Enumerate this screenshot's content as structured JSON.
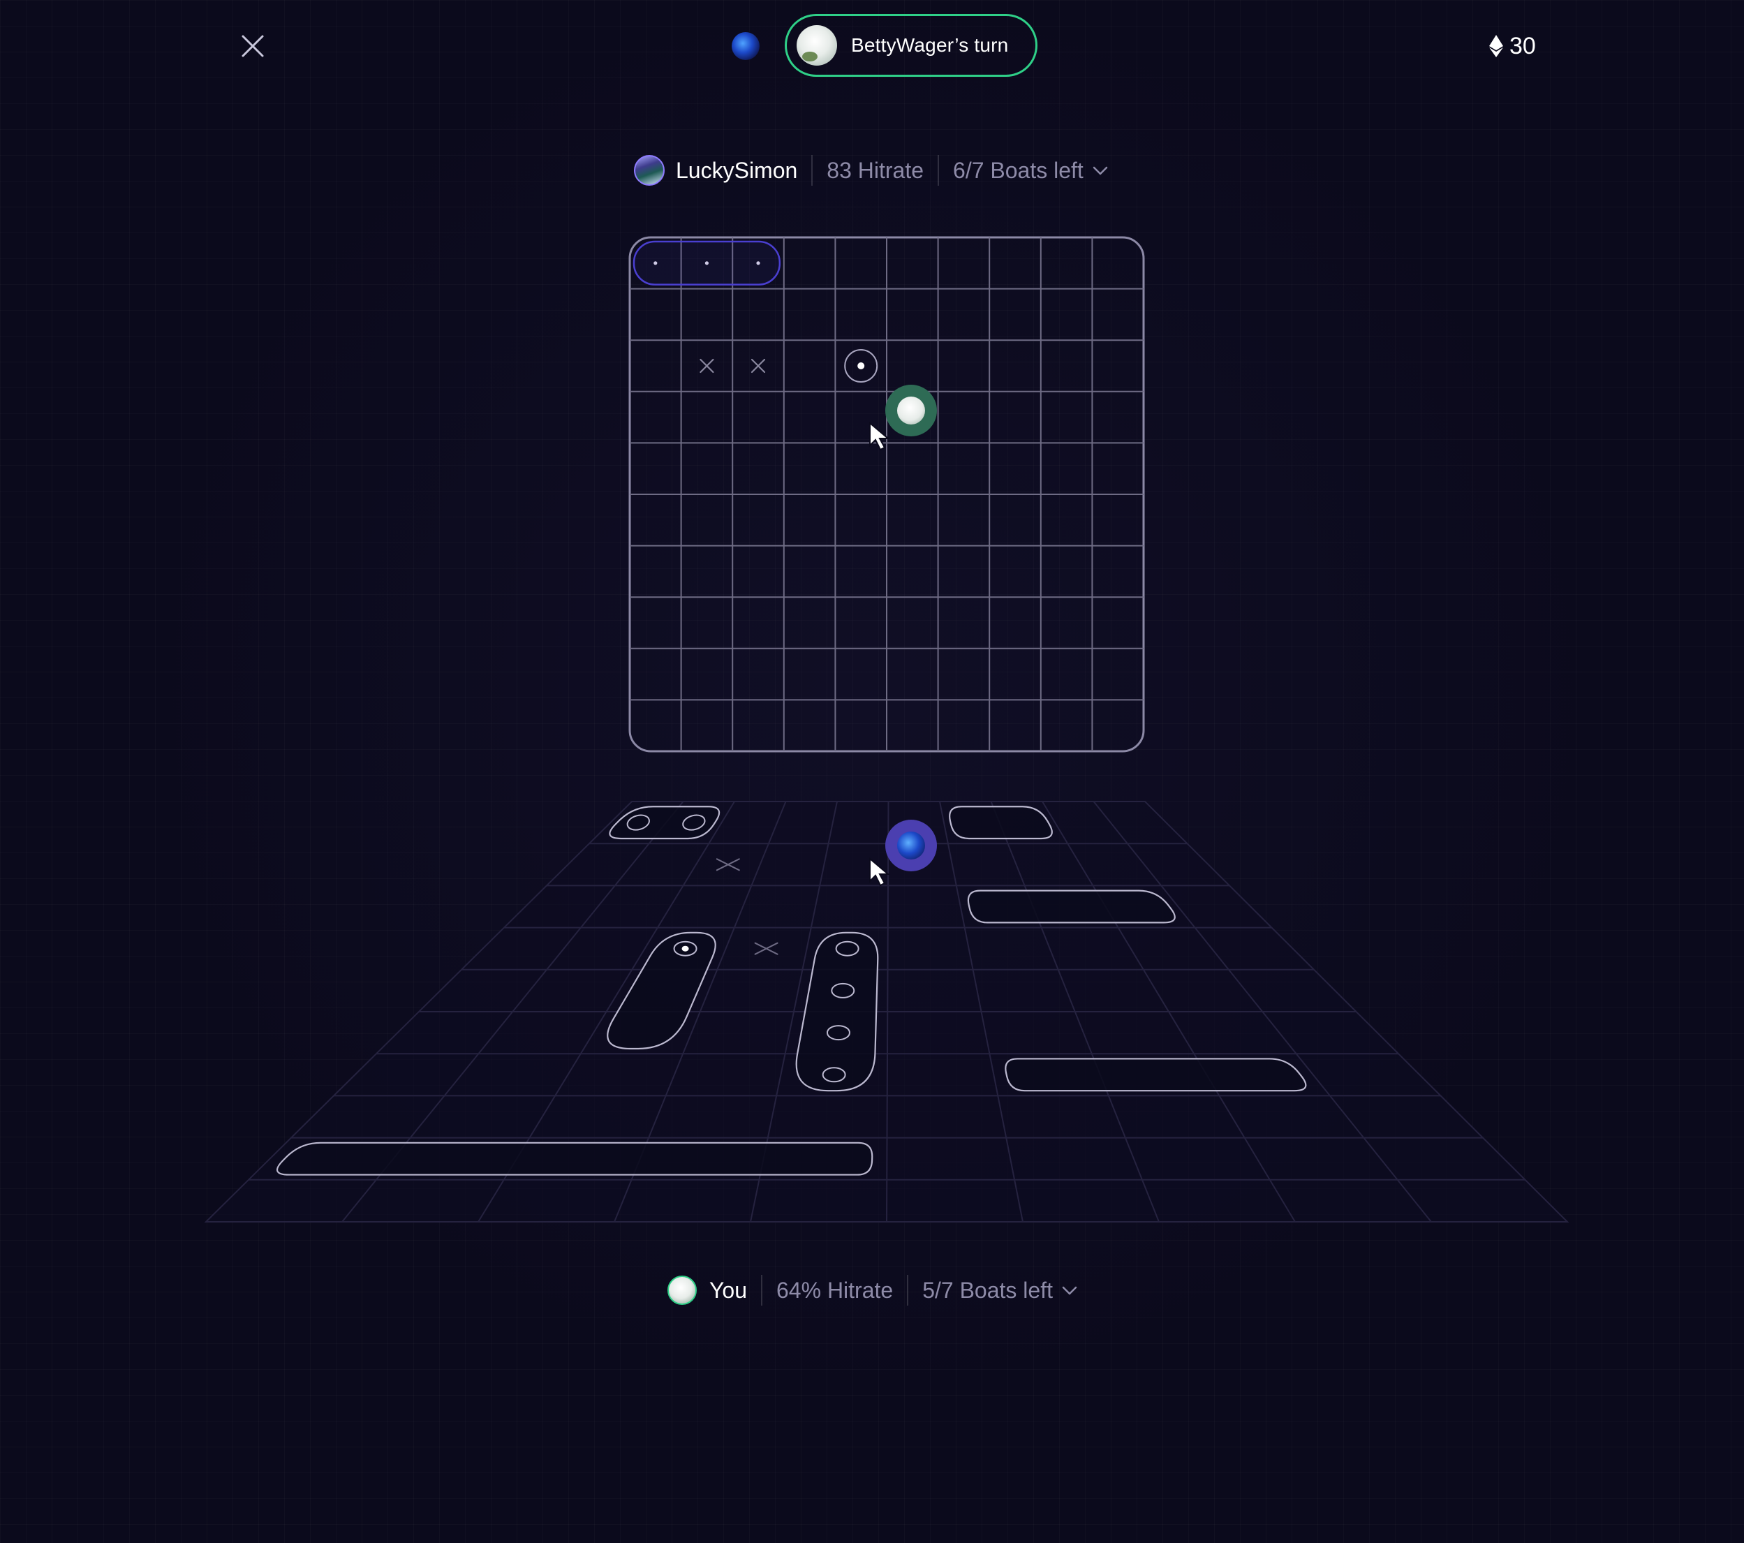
{
  "top_bar": {
    "close_icon": "close-icon",
    "turn_label": "BettyWager’s turn",
    "balance_icon": "ethereum-icon",
    "balance_value": "30"
  },
  "opponent": {
    "name": "LuckySimon",
    "hitrate": "83 Hitrate",
    "boats_left": "6/7 Boats left"
  },
  "player": {
    "name": "You",
    "hitrate": "64% Hitrate",
    "boats_left": "5/7 Boats left"
  },
  "colors": {
    "background": "#0b0a1c",
    "grid_line": "#6e6b84",
    "turn_border": "#2fd088",
    "opponent_cursor": "#2e6b55",
    "player_cursor": "#4b3fb0",
    "sunk_highlight": "#4a3fd0",
    "muted_text": "#8e8ba8"
  },
  "opponent_board": {
    "rows": 10,
    "cols": 10,
    "sunk_ship": {
      "row": 0,
      "col_start": 0,
      "length": 3
    },
    "misses": [
      {
        "row": 2,
        "col": 1
      },
      {
        "row": 2,
        "col": 2
      }
    ],
    "hits": [
      {
        "row": 2,
        "col": 4
      }
    ]
  },
  "player_board": {
    "rows": 10,
    "cols": 10,
    "ships": [
      {
        "row": 0,
        "col": 0,
        "length": 2,
        "orientation": "horizontal",
        "marks": [
          "empty",
          "empty"
        ]
      },
      {
        "row": 0,
        "col": 6,
        "length": 2,
        "orientation": "horizontal",
        "marks": []
      },
      {
        "row": 2,
        "col": 6,
        "length": 3,
        "orientation": "horizontal",
        "marks": []
      },
      {
        "row": 3,
        "col": 2,
        "length": 3,
        "orientation": "vertical",
        "marks": [
          "hit"
        ]
      },
      {
        "row": 3,
        "col": 4,
        "length": 4,
        "orientation": "vertical",
        "marks": [
          "empty",
          "empty",
          "empty",
          "empty"
        ]
      },
      {
        "row": 6,
        "col": 6,
        "length": 3,
        "orientation": "horizontal",
        "marks": []
      },
      {
        "row": 8,
        "col": 0,
        "length": 5,
        "orientation": "horizontal",
        "marks": []
      }
    ],
    "misses": [
      {
        "row": 1,
        "col": 2
      },
      {
        "row": 3,
        "col": 3
      }
    ]
  }
}
